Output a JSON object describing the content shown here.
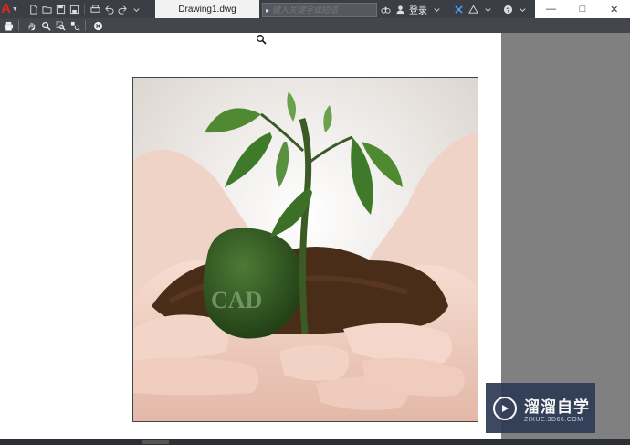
{
  "window": {
    "document_tab": "Drawing1.dwg",
    "search_placeholder": "键入关键字或短语",
    "login_label": "登录",
    "controls": {
      "minimize": "—",
      "maximize": "□",
      "close": "✕"
    }
  },
  "quick_access": [
    "new-icon",
    "open-icon",
    "save-icon",
    "saveas-icon",
    "plot-icon",
    "undo-icon",
    "redo-icon",
    "dropdown-icon"
  ],
  "plot_toolbar": [
    "print-icon",
    "pan-icon",
    "zoom-icon",
    "zoom-window-icon",
    "zoom-original-icon",
    "close-preview-icon"
  ],
  "image": {
    "embossed_text": "CAD",
    "colors": {
      "soil": "#4a2d18",
      "leaf": "#3f7a2a",
      "seed": "#2f5a1f",
      "skin": "#f0cfc1"
    }
  },
  "watermark": {
    "brand": "溜溜自学",
    "url": "ZIXUE.3D66.COM"
  }
}
